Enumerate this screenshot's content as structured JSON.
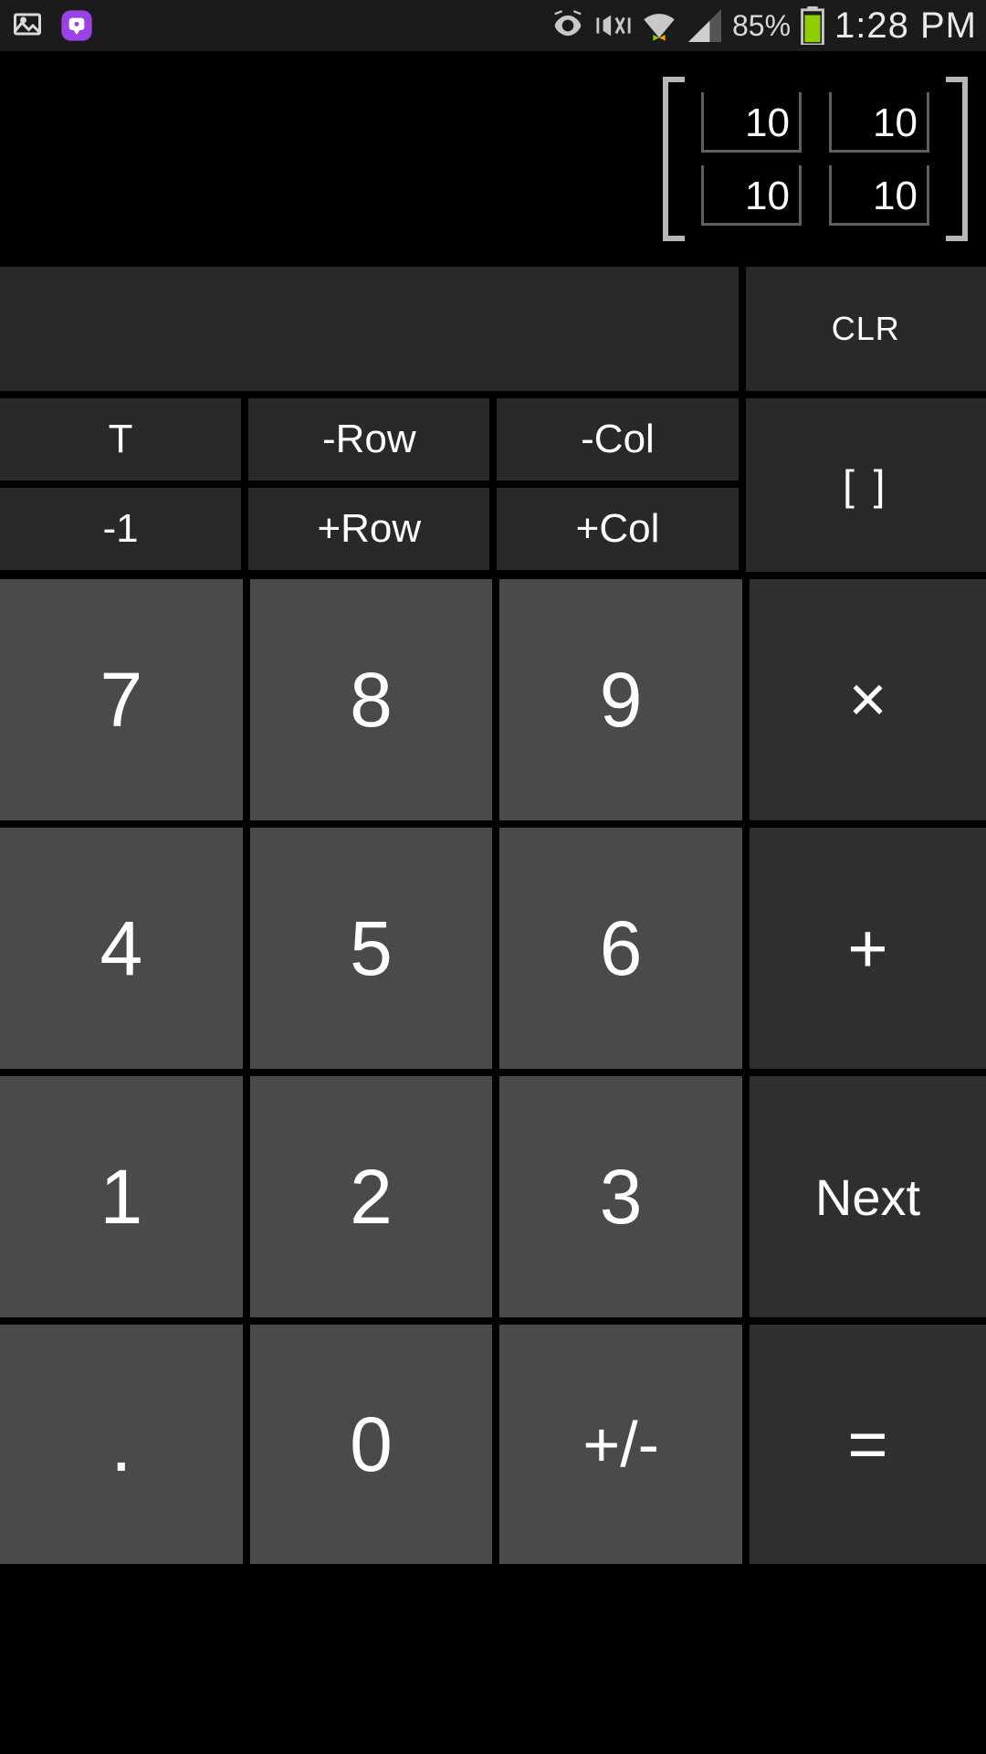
{
  "status": {
    "battery_pct": "85%",
    "time": "1:28 PM",
    "icons": {
      "picture": "picture-icon",
      "purple_app": "purple-chat-icon",
      "eye": "eye-icon",
      "vibrate": "vibrate-silent-icon",
      "wifi": "wifi-icon",
      "signal": "signal-icon",
      "battery": "battery-icon"
    }
  },
  "display": {
    "matrix": {
      "r1c1": "10",
      "r1c2": "10",
      "r2c1": "10",
      "r2c2": "10"
    }
  },
  "keys": {
    "clr": "CLR",
    "transpose": "T",
    "neg_row": "-Row",
    "neg_col": "-Col",
    "pos_row": "+Row",
    "pos_col": "+Col",
    "neg1": "-1",
    "brackets": "[ ]",
    "n7": "7",
    "n8": "8",
    "n9": "9",
    "n4": "4",
    "n5": "5",
    "n6": "6",
    "n1": "1",
    "n2": "2",
    "n3": "3",
    "n0": "0",
    "dot": ".",
    "plusminus": "+/-",
    "mul": "×",
    "add": "+",
    "next": "Next",
    "eq": "="
  }
}
